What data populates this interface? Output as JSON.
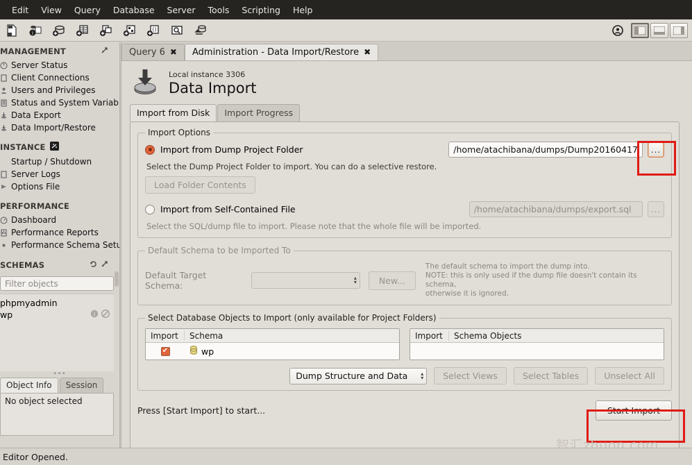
{
  "menubar": {
    "items": [
      "Edit",
      "View",
      "Query",
      "Database",
      "Server",
      "Tools",
      "Scripting",
      "Help"
    ]
  },
  "toolbar": {
    "icons": [
      "new-sql-tab-icon",
      "open-connection-info-icon",
      "create-schema-icon",
      "create-table-icon",
      "create-view-icon",
      "create-procedure-icon",
      "create-function-icon",
      "search-data-icon",
      "reconnect-server-icon"
    ],
    "right_icons": [
      "admin-target-icon",
      "toggle-sidebar-icon",
      "toggle-output-icon",
      "toggle-secondary-sidebar-icon"
    ]
  },
  "sidebar": {
    "management": {
      "title": "MANAGEMENT",
      "items": [
        {
          "label": "Server Status",
          "icon": "server-status-icon"
        },
        {
          "label": "Client Connections",
          "icon": "client-connections-icon"
        },
        {
          "label": "Users and Privileges",
          "icon": "users-privileges-icon"
        },
        {
          "label": "Status and System Variables",
          "icon": "status-variables-icon"
        },
        {
          "label": "Data Export",
          "icon": "data-export-icon"
        },
        {
          "label": "Data Import/Restore",
          "icon": "data-import-icon"
        }
      ]
    },
    "instance": {
      "title": "INSTANCE",
      "items": [
        {
          "label": "Startup / Shutdown",
          "icon": "startup-shutdown-icon"
        },
        {
          "label": "Server Logs",
          "icon": "server-logs-icon"
        },
        {
          "label": "Options File",
          "icon": "options-file-icon"
        }
      ]
    },
    "performance": {
      "title": "PERFORMANCE",
      "items": [
        {
          "label": "Dashboard",
          "icon": "dashboard-icon"
        },
        {
          "label": "Performance Reports",
          "icon": "performance-reports-icon"
        },
        {
          "label": "Performance Schema Setup",
          "icon": "performance-schema-icon"
        }
      ]
    },
    "schemas": {
      "title": "SCHEMAS",
      "filter_placeholder": "Filter objects",
      "items": [
        {
          "label": "phpmyadmin",
          "icons": []
        },
        {
          "label": "wp",
          "icons": [
            "info-icon",
            "blocked-icon"
          ]
        }
      ]
    },
    "object_panel": {
      "tabs": [
        {
          "label": "Object Info",
          "active": true
        },
        {
          "label": "Session",
          "active": false
        }
      ],
      "body_text": "No object selected"
    }
  },
  "window_tabs": [
    {
      "label": "Query 6",
      "active": false
    },
    {
      "label": "Administration - Data Import/Restore",
      "active": true
    }
  ],
  "page": {
    "instance_label": "Local instance 3306",
    "title": "Data Import",
    "icon": "data-import-icon",
    "subtabs": [
      {
        "label": "Import from Disk",
        "active": true
      },
      {
        "label": "Import Progress",
        "active": false
      }
    ]
  },
  "import_options": {
    "legend": "Import Options",
    "dump_folder": {
      "radio_label": "Import from Dump Project Folder",
      "selected": true,
      "path_value": "/home/atachibana/dumps/Dump20160417",
      "browse_label": "...",
      "hint": "Select the Dump Project Folder to import. You can do a selective restore.",
      "load_button": "Load Folder Contents"
    },
    "self_contained": {
      "radio_label": "Import from Self-Contained File",
      "selected": false,
      "path_placeholder": "/home/atachibana/dumps/export.sql",
      "browse_label": "...",
      "hint": "Select the SQL/dump file to import. Please note that the whole file will be imported."
    }
  },
  "default_schema": {
    "legend": "Default Schema to be Imported To",
    "field_label": "Default Target Schema:",
    "value": "",
    "new_button": "New...",
    "note_line1": "The default schema to import the dump into.",
    "note_line2": "NOTE: this is only used if the dump file doesn't contain its schema,",
    "note_line3": "otherwise it is ignored."
  },
  "objects": {
    "legend": "Select Database Objects to Import (only available for Project Folders)",
    "left_table": {
      "headers": [
        "Import",
        "Schema"
      ],
      "rows": [
        {
          "checked": true,
          "icon": "schema-icon",
          "name": "wp"
        }
      ]
    },
    "right_table": {
      "headers": [
        "Import",
        "Schema Objects"
      ],
      "rows": []
    },
    "dump_type_value": "Dump Structure and Data",
    "buttons": [
      "Select Views",
      "Select Tables",
      "Unselect All"
    ]
  },
  "footer": {
    "status_text": "Press [Start Import] to start...",
    "start_button": "Start Import"
  },
  "watermark": "智汇zhuon.com",
  "statusbar": {
    "text": "Editor Opened."
  },
  "colors": {
    "menu_bg": "#262421",
    "accent_orange": "#e0653a",
    "annotation_red": "#e01b14",
    "window_bg": "#d6d2cc"
  }
}
